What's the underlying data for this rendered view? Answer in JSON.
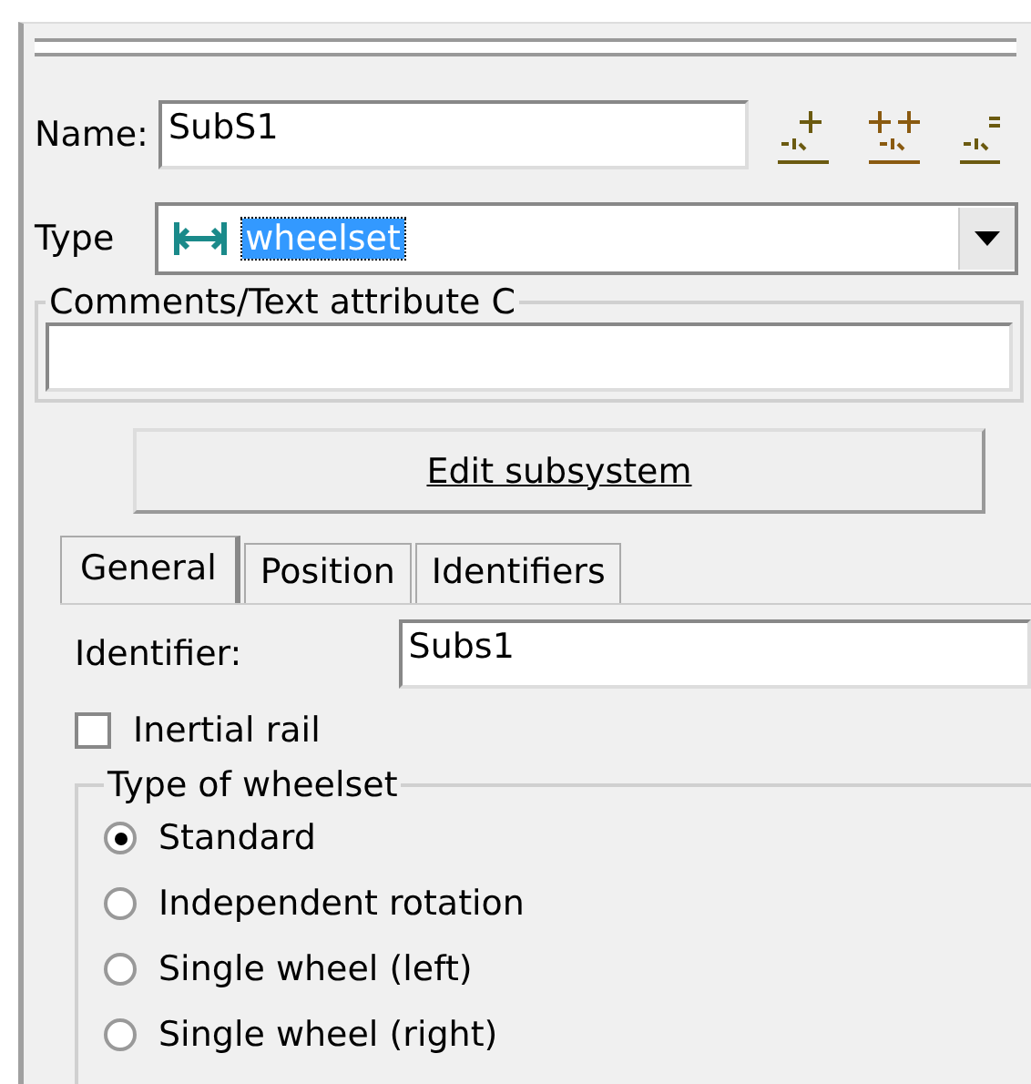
{
  "name_field": {
    "label": "Name:",
    "value": "SubS1"
  },
  "type_field": {
    "label": "Type",
    "value": "wheelset",
    "highlighted": true
  },
  "comments": {
    "label": "Comments/Text attribute C"
  },
  "edit_button": {
    "label": "Edit subsystem"
  },
  "tabs": [
    {
      "label": "General",
      "selected": true
    },
    {
      "label": "Position",
      "selected": false
    },
    {
      "label": "Identifiers",
      "selected": false
    }
  ],
  "identifier": {
    "label": "Identifier:",
    "value": "Subs1"
  },
  "inertial_rail": {
    "label": "Inertial rail",
    "checked": false
  },
  "wheelset_type": {
    "title": "Type of wheelset",
    "options": [
      {
        "label": "Standard",
        "selected": true
      },
      {
        "label": "Independent rotation",
        "selected": false
      },
      {
        "label": "Single wheel (left)",
        "selected": false
      },
      {
        "label": "Single wheel (right)",
        "selected": false
      }
    ]
  }
}
